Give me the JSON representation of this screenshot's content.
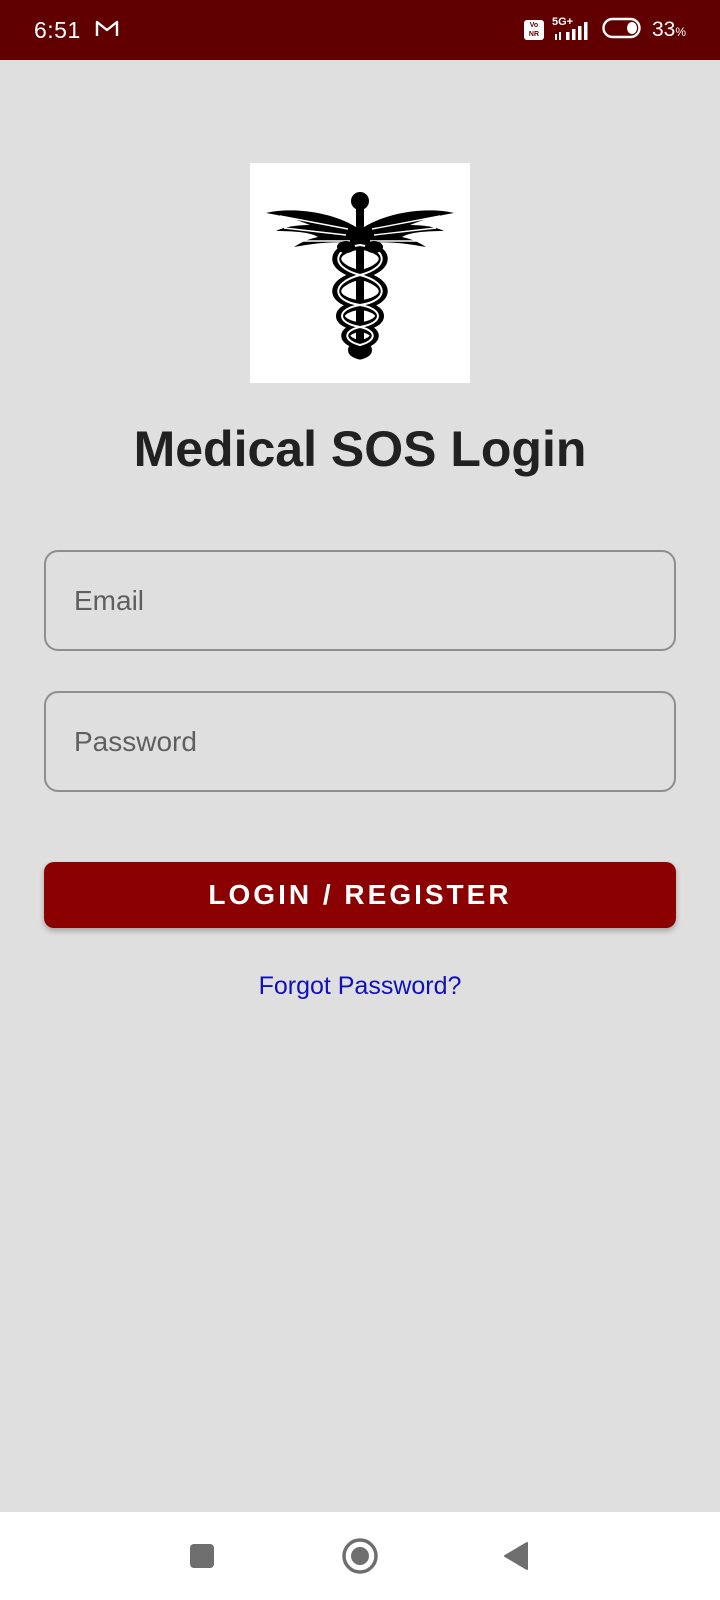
{
  "status_bar": {
    "time": "6:51",
    "gmail_icon": "gmail-icon",
    "volte_badge": "Vo\nNR",
    "network": "5G+",
    "battery_percent": "33",
    "battery_unit": "%"
  },
  "logo": {
    "icon": "caduceus-icon"
  },
  "title": "Medical SOS Login",
  "form": {
    "email_placeholder": "Email",
    "password_placeholder": "Password",
    "submit_label": "LOGIN / REGISTER",
    "forgot_label": "Forgot Password?"
  },
  "nav": {
    "recents_icon": "square-icon",
    "home_icon": "circle-icon",
    "back_icon": "triangle-back-icon"
  },
  "colors": {
    "status_bar": "#610000",
    "background": "#dfdfdf",
    "button": "#8b0000",
    "link": "#1111bb"
  }
}
